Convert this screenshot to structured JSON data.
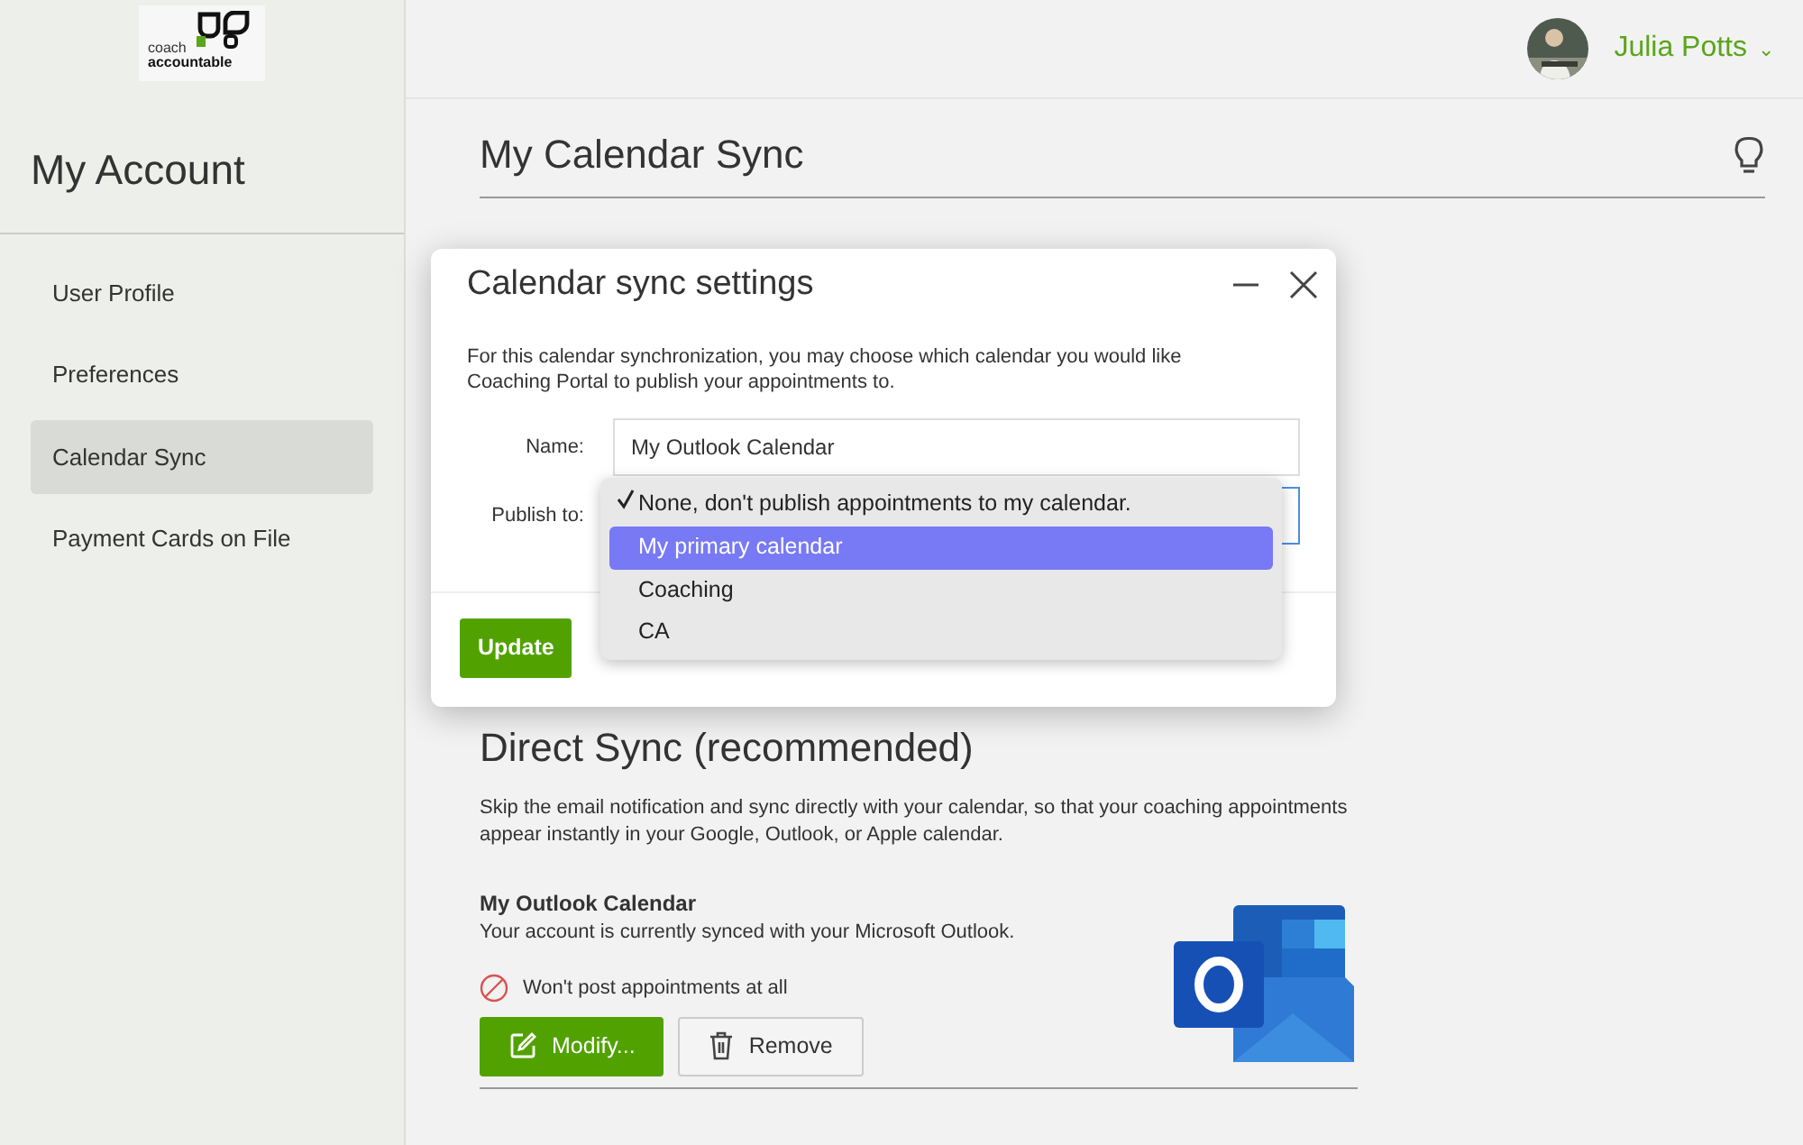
{
  "logo": {
    "line_1": "coach",
    "line_2": "accountable"
  },
  "sidebar": {
    "title": "My Account",
    "items": [
      {
        "label": "User Profile",
        "selected": false
      },
      {
        "label": "Preferences",
        "selected": false
      },
      {
        "label": "Calendar Sync",
        "selected": true
      },
      {
        "label": "Payment Cards on File",
        "selected": false
      }
    ]
  },
  "user": {
    "name": "Julia Potts",
    "caret": "⌄"
  },
  "page": {
    "title": "My Calendar Sync"
  },
  "modal": {
    "title": "Calendar sync settings",
    "description": "For this calendar synchronization, you may choose which calendar you would like Coaching Portal to publish your appointments to.",
    "name_label": "Name:",
    "name_value": "My Outlook Calendar",
    "publish_label": "Publish to:",
    "options": [
      {
        "label": "None, don't publish appointments to my calendar.",
        "checked": true,
        "highlighted": false
      },
      {
        "label": "My primary calendar",
        "checked": false,
        "highlighted": true
      },
      {
        "label": "Coaching",
        "checked": false,
        "highlighted": false
      },
      {
        "label": "CA",
        "checked": false,
        "highlighted": false
      }
    ],
    "update_button": "Update"
  },
  "direct_sync": {
    "title": "Direct Sync (recommended)",
    "description": "Skip the email notification and sync directly with your calendar, so that your coaching appointments appear instantly in your Google, Outlook, or Apple calendar.",
    "calendar_name": "My Outlook Calendar",
    "calendar_status": "Your account is currently synced with your Microsoft Outlook.",
    "posting_status": "Won't post appointments at all",
    "modify_button": "Modify...",
    "remove_button": "Remove"
  }
}
